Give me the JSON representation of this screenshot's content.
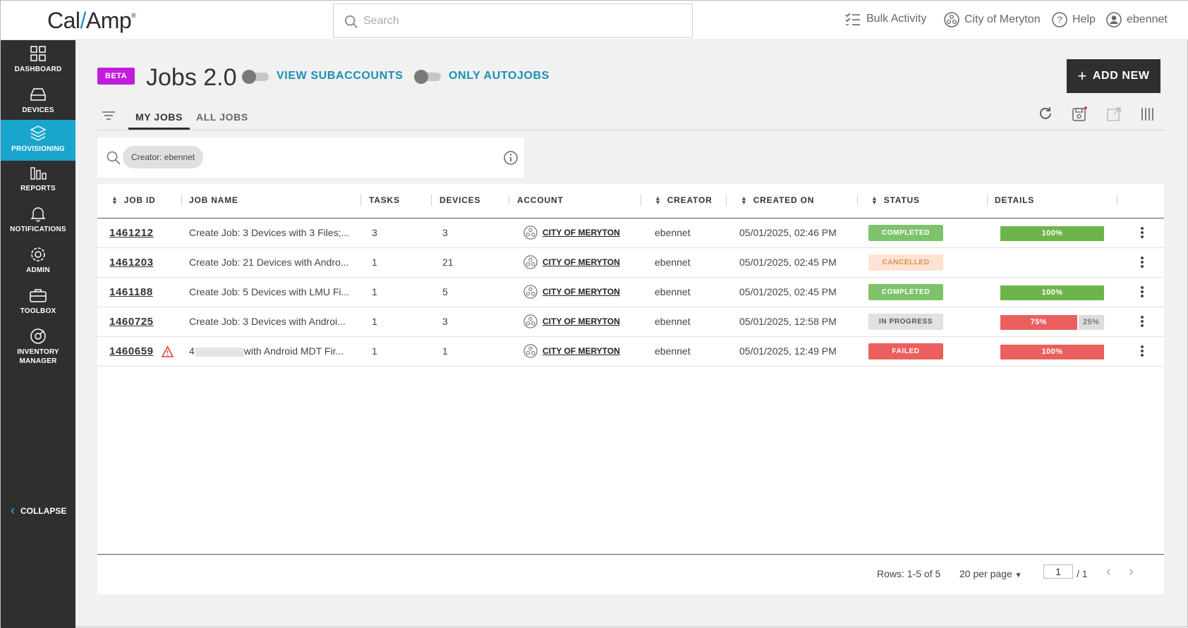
{
  "header": {
    "logo": {
      "left": "Cal",
      "slash": "/",
      "right": "Amp",
      "mark": "®"
    },
    "search_placeholder": "Search",
    "nav": {
      "bulk_activity": "Bulk Activity",
      "account": "City of Meryton",
      "help": "Help",
      "user": "ebennet"
    }
  },
  "sidebar": {
    "items": [
      {
        "label": "DASHBOARD",
        "icon": "dashboard-icon"
      },
      {
        "label": "DEVICES",
        "icon": "devices-icon"
      },
      {
        "label": "PROVISIONING",
        "icon": "layers-icon",
        "active": true
      },
      {
        "label": "REPORTS",
        "icon": "bar-chart-icon"
      },
      {
        "label": "NOTIFICATIONS",
        "icon": "bell-icon"
      },
      {
        "label": "ADMIN",
        "icon": "gear-icon"
      },
      {
        "label": "TOOLBOX",
        "icon": "toolbox-icon"
      },
      {
        "label": "INVENTORY",
        "label2": "MANAGER",
        "icon": "inventory-icon"
      }
    ],
    "collapse_label": "COLLAPSE"
  },
  "page": {
    "beta_badge": "BETA",
    "title": "Jobs 2.0",
    "toggles": [
      {
        "label": "VIEW SUBACCOUNTS",
        "on": false
      },
      {
        "label": "ONLY AUTOJOBS",
        "on": false
      }
    ],
    "add_new_label": "ADD NEW",
    "tabs": [
      {
        "label": "MY JOBS",
        "active": true
      },
      {
        "label": "ALL JOBS",
        "active": false
      }
    ],
    "filter_chip": "Creator: ebennet"
  },
  "table": {
    "columns": [
      "JOB ID",
      "JOB NAME",
      "TASKS",
      "DEVICES",
      "ACCOUNT",
      "CREATOR",
      "CREATED ON",
      "STATUS",
      "DETAILS"
    ],
    "rows": [
      {
        "job_id": "1461212",
        "job_name": "Create Job: 3 Devices with 3 Files;...",
        "tasks": "3",
        "devices": "3",
        "account": "CITY OF MERYTON",
        "creator": "ebennet",
        "created_on": "05/01/2025, 02:46 PM",
        "status": "COMPLETED",
        "progress": [
          {
            "label": "100%",
            "value": 100,
            "color": "#6db54a"
          }
        ]
      },
      {
        "job_id": "1461203",
        "job_name": "Create Job: 21 Devices with Andro...",
        "tasks": "1",
        "devices": "21",
        "account": "CITY OF MERYTON",
        "creator": "ebennet",
        "created_on": "05/01/2025, 02:45 PM",
        "status": "CANCELLED",
        "progress": []
      },
      {
        "job_id": "1461188",
        "job_name": "Create Job: 5 Devices with LMU Fi...",
        "tasks": "1",
        "devices": "5",
        "account": "CITY OF MERYTON",
        "creator": "ebennet",
        "created_on": "05/01/2025, 02:45 PM",
        "status": "COMPLETED",
        "progress": [
          {
            "label": "100%",
            "value": 100,
            "color": "#6db54a"
          }
        ]
      },
      {
        "job_id": "1460725",
        "job_name": "Create Job: 3 Devices with Androi...",
        "tasks": "1",
        "devices": "3",
        "account": "CITY OF MERYTON",
        "creator": "ebennet",
        "created_on": "05/01/2025, 12:58 PM",
        "status": "IN PROGRESS",
        "progress": [
          {
            "label": "75%",
            "value": 75,
            "color": "#ec5f5f"
          },
          {
            "label": "25%",
            "value": 25,
            "color": "#dcdcdc"
          }
        ]
      },
      {
        "job_id": "1460659",
        "job_name_prefix": "4",
        "job_name": "with Android MDT Fir...",
        "tasks": "1",
        "devices": "1",
        "account": "CITY OF MERYTON",
        "creator": "ebennet",
        "created_on": "05/01/2025, 12:49 PM",
        "status": "FAILED",
        "warning": true,
        "progress": [
          {
            "label": "100%",
            "value": 100,
            "color": "#ec5f5f"
          }
        ]
      }
    ]
  },
  "footer": {
    "rows_info": "Rows: 1-5 of 5",
    "per_page": "20 per page",
    "page_current": "1",
    "page_total": "/ 1"
  },
  "colors": {
    "accent": "#1aa5cc",
    "link_blue": "#1a8fb3",
    "beta": "#c21ddc",
    "completed": "#7ec36b",
    "failed": "#ec5f5f",
    "cancelled_bg": "#fde3d3"
  }
}
